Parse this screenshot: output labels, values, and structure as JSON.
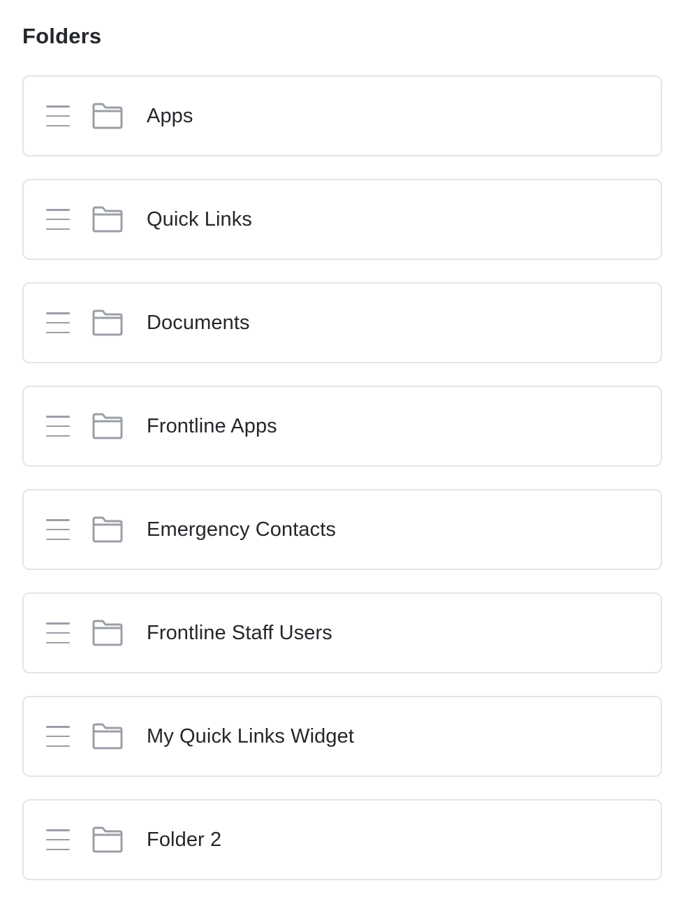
{
  "header": {
    "title": "Folders"
  },
  "icons": {
    "drag": "drag-handle-icon",
    "folder": "folder-icon"
  },
  "colors": {
    "border": "#e3e5e8",
    "icon": "#9a9ea6",
    "text": "#24272b"
  },
  "folders": [
    {
      "name": "Apps"
    },
    {
      "name": "Quick Links"
    },
    {
      "name": "Documents"
    },
    {
      "name": "Frontline Apps"
    },
    {
      "name": "Emergency Contacts"
    },
    {
      "name": "Frontline Staff Users"
    },
    {
      "name": "My Quick Links Widget"
    },
    {
      "name": "Folder 2"
    }
  ]
}
